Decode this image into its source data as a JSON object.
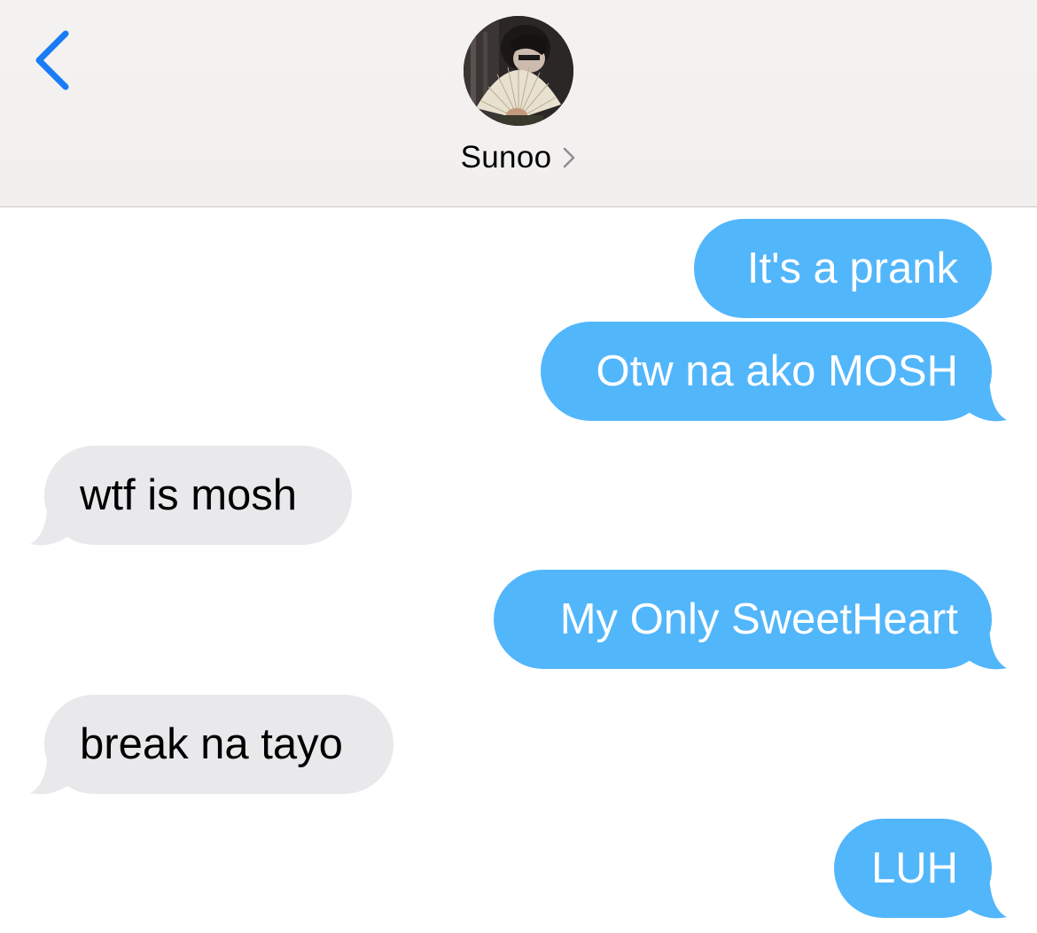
{
  "header": {
    "contact_name": "Sunoo",
    "back_icon": "chevron-left-icon",
    "details_icon": "chevron-right-icon"
  },
  "colors": {
    "sent_bubble": "#52b6fb",
    "received_bubble": "#e9e9ec",
    "accent_blue": "#1a7cf5"
  },
  "messages": [
    {
      "direction": "sent",
      "text": "It's a prank"
    },
    {
      "direction": "sent",
      "text": "Otw na ako MOSH"
    },
    {
      "direction": "received",
      "text": "wtf is mosh"
    },
    {
      "direction": "sent",
      "text": "My Only SweetHeart"
    },
    {
      "direction": "received",
      "text": "break na tayo"
    },
    {
      "direction": "sent",
      "text": "LUH"
    }
  ]
}
